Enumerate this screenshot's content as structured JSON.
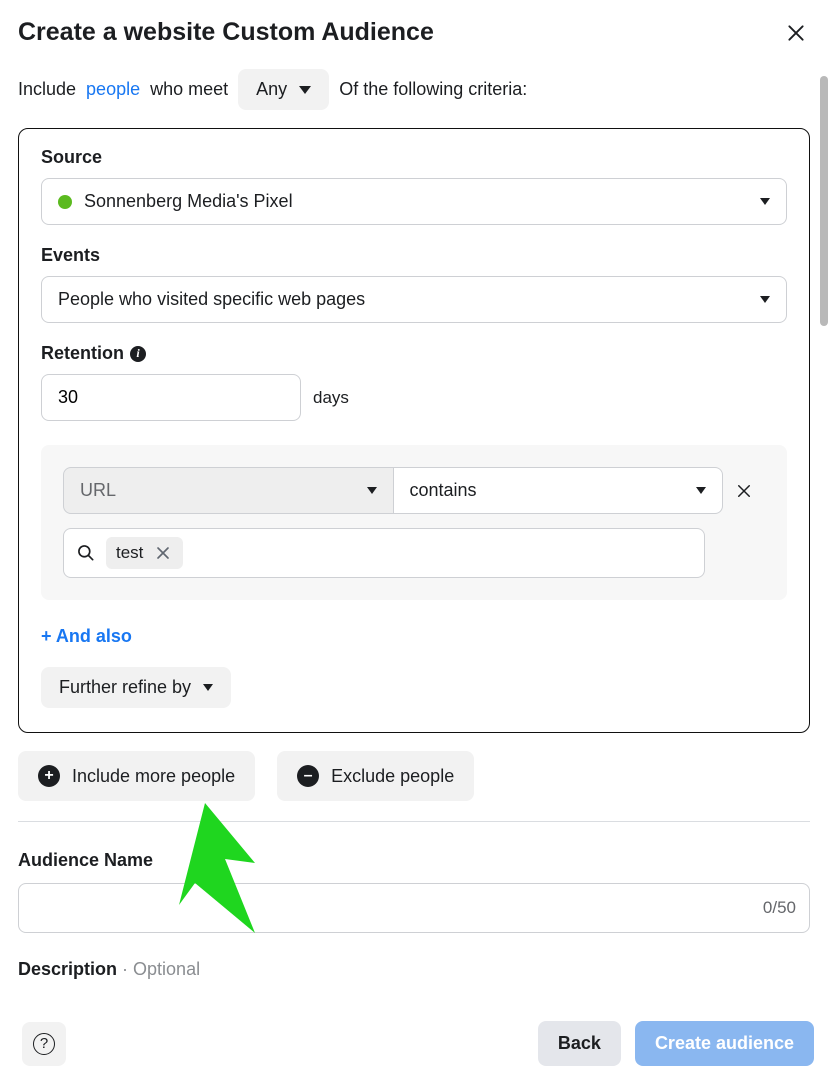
{
  "header": {
    "title": "Create a website Custom Audience"
  },
  "criteria": {
    "include_prefix": "Include",
    "people_link": "people",
    "who_meet": "who meet",
    "any_label": "Any",
    "of_following": "Of the following criteria:"
  },
  "panel": {
    "source_label": "Source",
    "source_value": "Sonnenberg Media's Pixel",
    "events_label": "Events",
    "events_value": "People who visited specific web pages",
    "retention_label": "Retention",
    "retention_value": "30",
    "retention_unit": "days",
    "rule": {
      "field": "URL",
      "operator": "contains",
      "chip": "test"
    },
    "and_also": "+ And also",
    "refine_label": "Further refine by"
  },
  "actions": {
    "include_more": "Include more people",
    "exclude": "Exclude people"
  },
  "audience_name": {
    "label": "Audience Name",
    "counter": "0/50"
  },
  "description": {
    "label": "Description",
    "separator": " · ",
    "optional": "Optional"
  },
  "footer": {
    "back": "Back",
    "create": "Create audience"
  }
}
